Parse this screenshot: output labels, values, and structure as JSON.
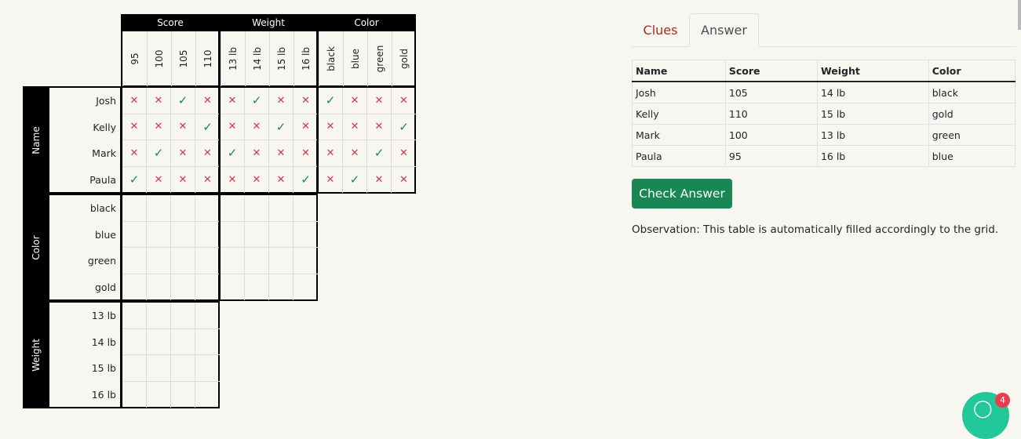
{
  "grid": {
    "top_groups": [
      {
        "label": "Score",
        "items": [
          "95",
          "100",
          "105",
          "110"
        ]
      },
      {
        "label": "Weight",
        "items": [
          "13 lb",
          "14 lb",
          "15 lb",
          "16 lb"
        ]
      },
      {
        "label": "Color",
        "items": [
          "black",
          "blue",
          "green",
          "gold"
        ]
      }
    ],
    "left_groups": [
      {
        "label": "Name",
        "items": [
          "Josh",
          "Kelly",
          "Mark",
          "Paula"
        ]
      },
      {
        "label": "Color",
        "items": [
          "black",
          "blue",
          "green",
          "gold"
        ]
      },
      {
        "label": "Weight",
        "items": [
          "13 lb",
          "14 lb",
          "15 lb",
          "16 lb"
        ]
      }
    ],
    "marks": {
      "name_score": [
        [
          "x",
          "x",
          "v",
          "x"
        ],
        [
          "x",
          "x",
          "x",
          "v"
        ],
        [
          "x",
          "v",
          "x",
          "x"
        ],
        [
          "v",
          "x",
          "x",
          "x"
        ]
      ],
      "name_weight": [
        [
          "x",
          "v",
          "x",
          "x"
        ],
        [
          "x",
          "x",
          "v",
          "x"
        ],
        [
          "v",
          "x",
          "x",
          "x"
        ],
        [
          "x",
          "x",
          "x",
          "v"
        ]
      ],
      "name_color": [
        [
          "v",
          "x",
          "x",
          "x"
        ],
        [
          "x",
          "x",
          "x",
          "v"
        ],
        [
          "x",
          "x",
          "v",
          "x"
        ],
        [
          "x",
          "v",
          "x",
          "x"
        ]
      ],
      "color_score": [
        [
          "",
          "",
          "",
          ""
        ],
        [
          "",
          "",
          "",
          ""
        ],
        [
          "",
          "",
          "",
          ""
        ],
        [
          "",
          "",
          "",
          ""
        ]
      ],
      "color_weight": [
        [
          "",
          "",
          "",
          ""
        ],
        [
          "",
          "",
          "",
          ""
        ],
        [
          "",
          "",
          "",
          ""
        ],
        [
          "",
          "",
          "",
          ""
        ]
      ],
      "weight_score": [
        [
          "",
          "",
          "",
          ""
        ],
        [
          "",
          "",
          "",
          ""
        ],
        [
          "",
          "",
          "",
          ""
        ],
        [
          "",
          "",
          "",
          ""
        ]
      ]
    },
    "symbols": {
      "x": "✕",
      "v": "✓"
    }
  },
  "tabs": [
    {
      "label": "Clues",
      "active": false
    },
    {
      "label": "Answer",
      "active": true
    }
  ],
  "answer_table": {
    "headers": [
      "Name",
      "Score",
      "Weight",
      "Color"
    ],
    "rows": [
      [
        "Josh",
        "105",
        "14 lb",
        "black"
      ],
      [
        "Kelly",
        "110",
        "15 lb",
        "gold"
      ],
      [
        "Mark",
        "100",
        "13 lb",
        "green"
      ],
      [
        "Paula",
        "95",
        "16 lb",
        "blue"
      ]
    ]
  },
  "check_button": "Check Answer",
  "observation": "Observation: This table is automatically filled accordingly to the grid.",
  "notification_badge": "4",
  "colors": {
    "clues_tab": "#b02a1a",
    "check_button": "#198754",
    "cross": "#dc3545",
    "check": "#198754",
    "fab": "#20c997",
    "badge": "#f0394a"
  }
}
